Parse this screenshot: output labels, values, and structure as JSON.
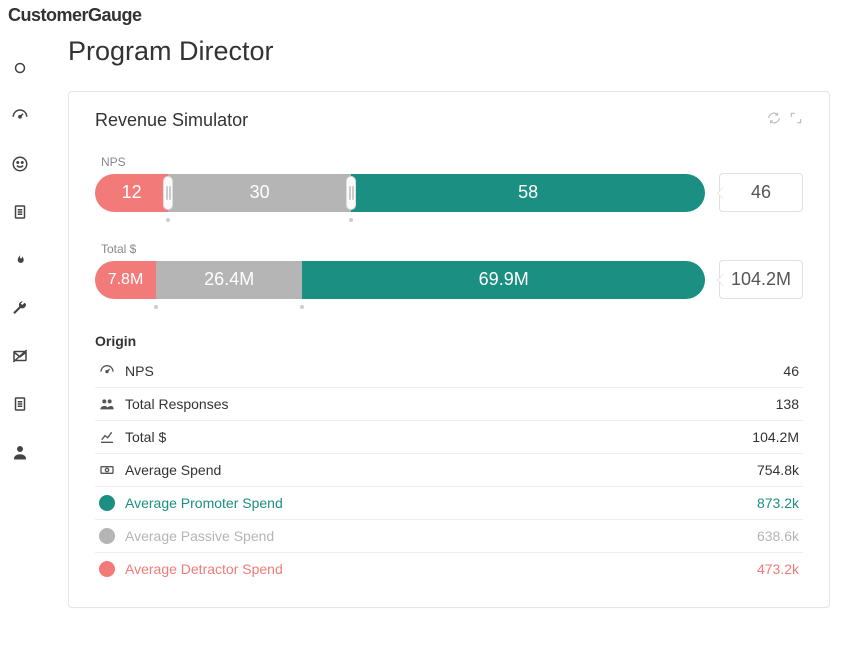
{
  "brand": "CustomerGauge",
  "page_title": "Program Director",
  "card": {
    "title": "Revenue Simulator",
    "nps": {
      "label": "NPS",
      "detractor": 12,
      "passive": 30,
      "promoter": 58,
      "total": 46
    },
    "total_dollar": {
      "label": "Total $",
      "detractor": "7.8M",
      "passive": "26.4M",
      "promoter": "69.9M",
      "total": "104.2M"
    }
  },
  "origin_label": "Origin",
  "origin": [
    {
      "key": "nps",
      "label": "NPS",
      "value": "46",
      "icon": "gauge"
    },
    {
      "key": "responses",
      "label": "Total Responses",
      "value": "138",
      "icon": "users"
    },
    {
      "key": "total",
      "label": "Total $",
      "value": "104.2M",
      "icon": "chart-line"
    },
    {
      "key": "avg",
      "label": "Average Spend",
      "value": "754.8k",
      "icon": "money"
    },
    {
      "key": "avg_prom",
      "label": "Average Promoter Spend",
      "value": "873.2k",
      "icon": "swatch-promoter"
    },
    {
      "key": "avg_pass",
      "label": "Average Passive Spend",
      "value": "638.6k",
      "icon": "swatch-passive"
    },
    {
      "key": "avg_detr",
      "label": "Average Detractor Spend",
      "value": "473.2k",
      "icon": "swatch-detractor"
    }
  ],
  "colors": {
    "promoter": "#1b8f82",
    "passive": "#b5b5b5",
    "detractor": "#f27b7a"
  }
}
